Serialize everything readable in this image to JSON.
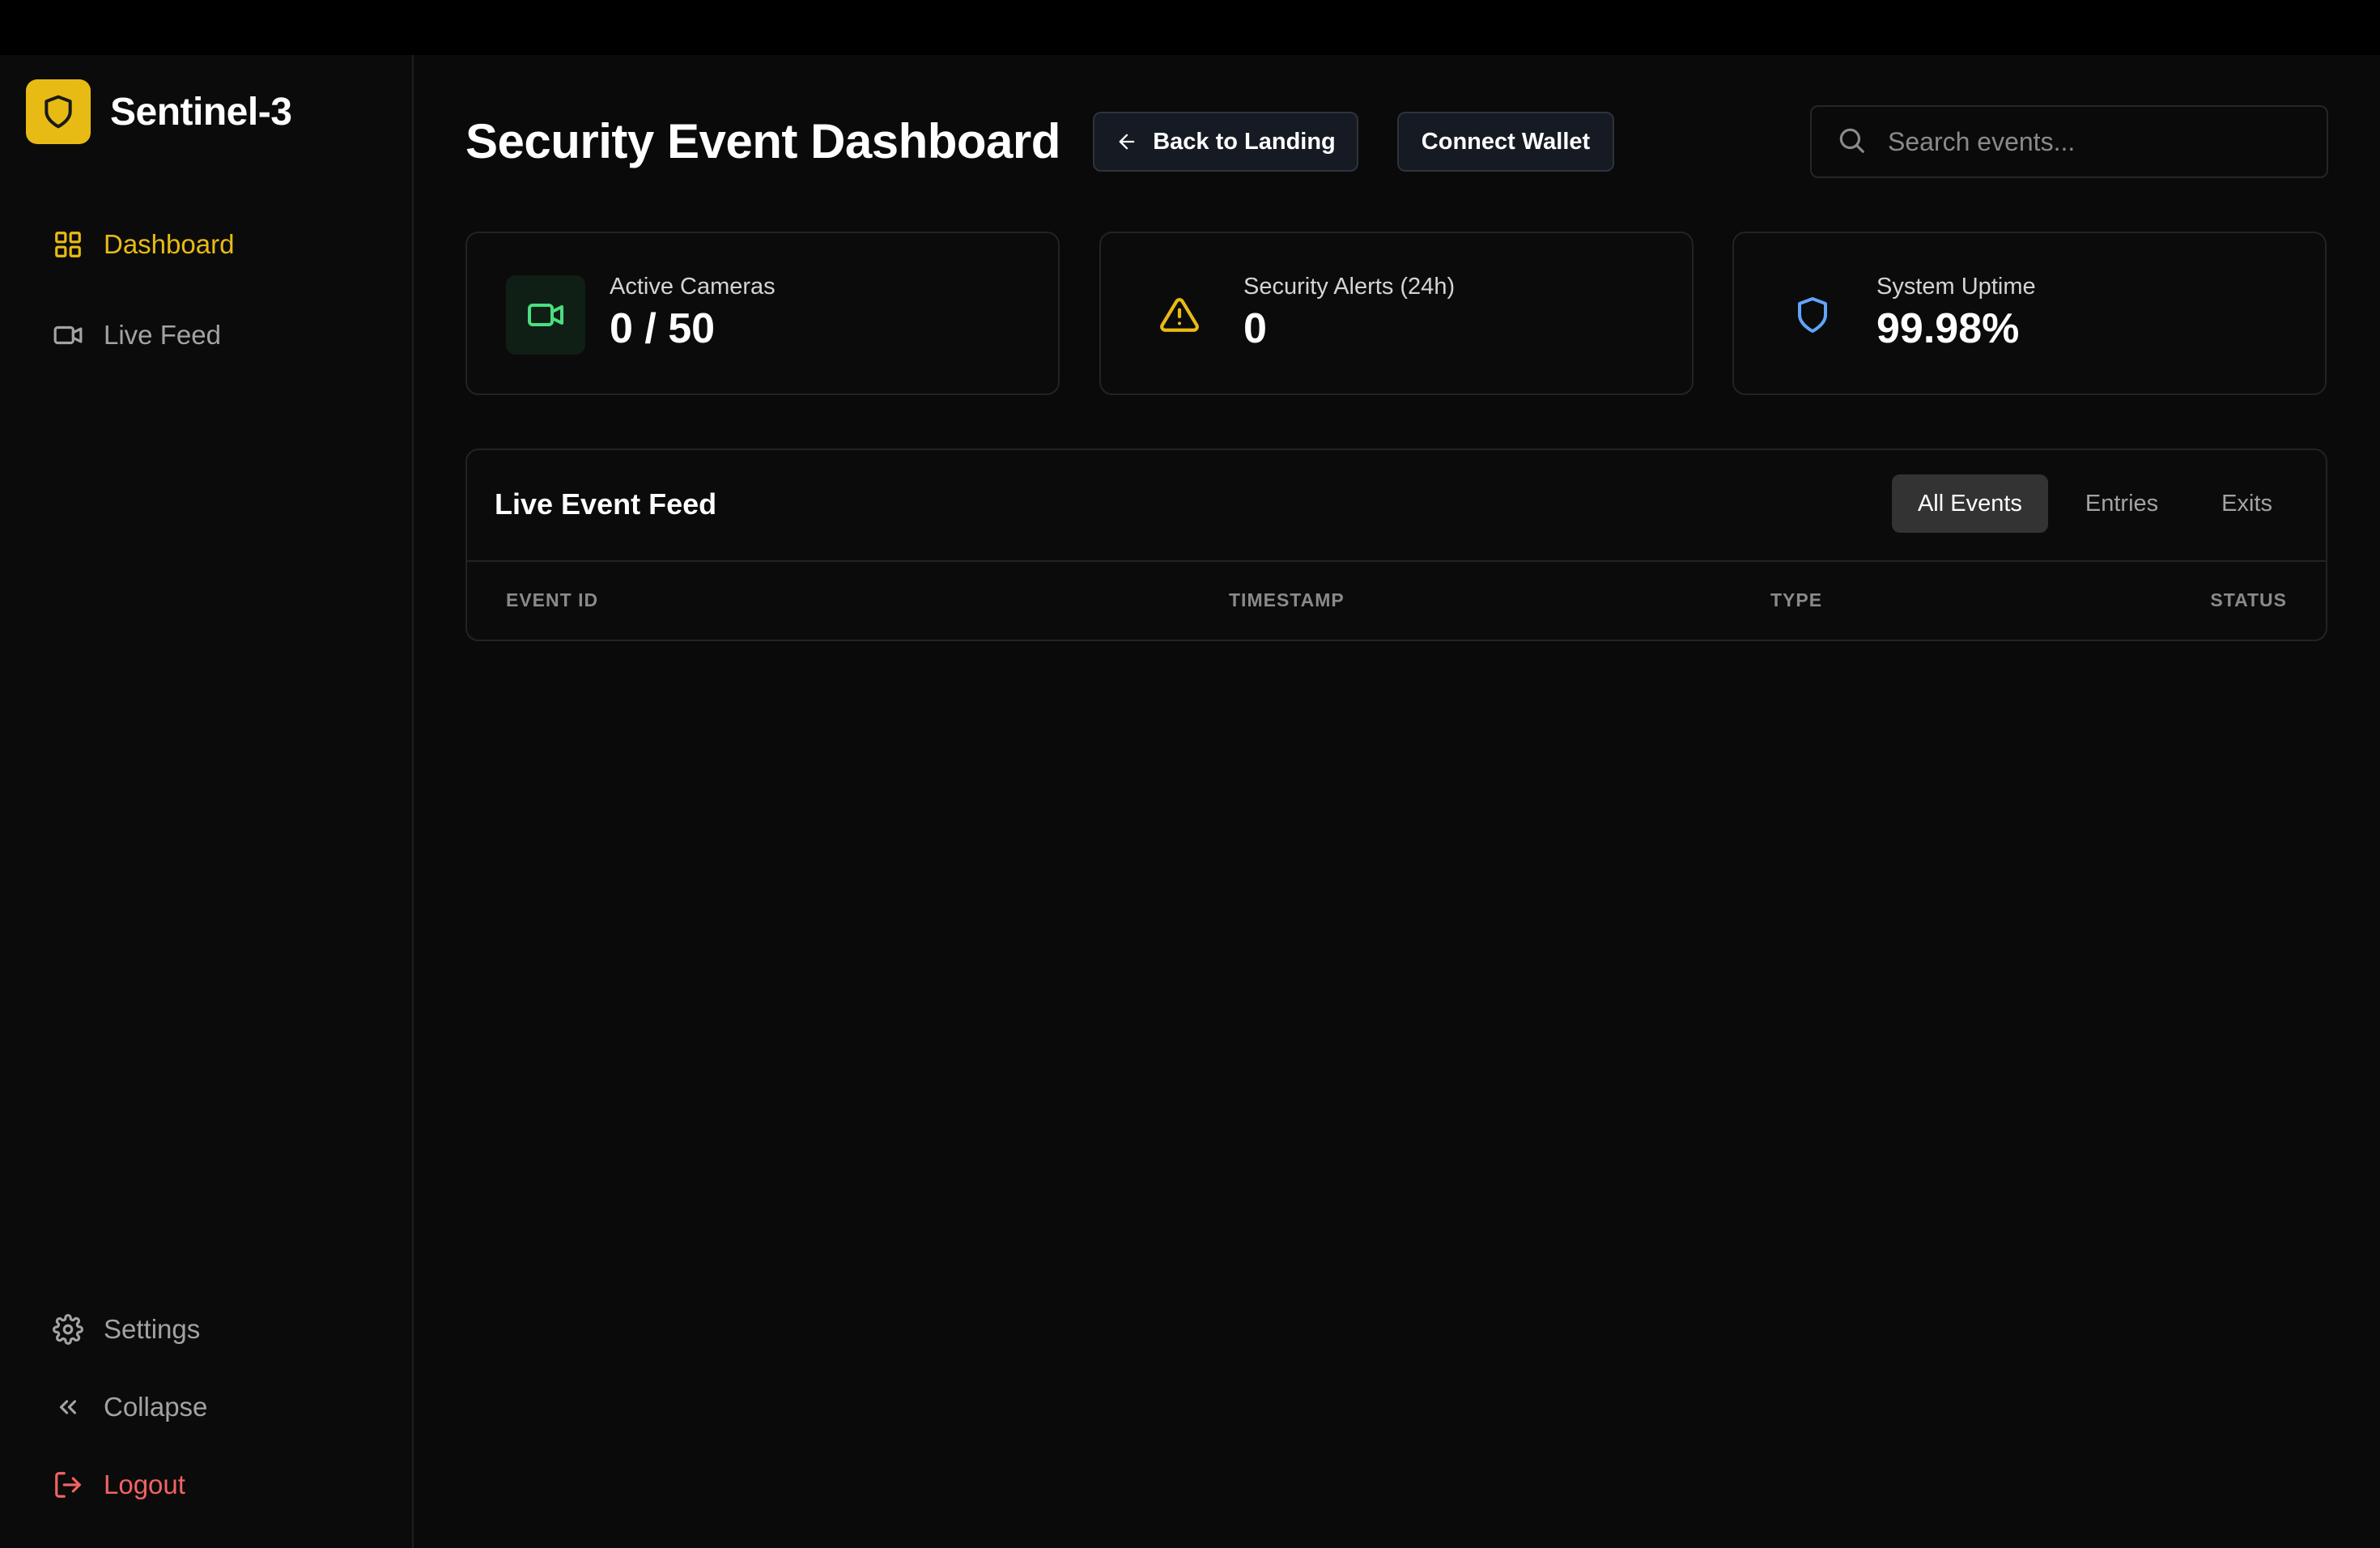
{
  "brand": {
    "name": "Sentinel-3"
  },
  "sidebar": {
    "items": [
      {
        "label": "Dashboard",
        "icon": "grid-icon",
        "active": true
      },
      {
        "label": "Live Feed",
        "icon": "video-icon",
        "active": false
      }
    ],
    "bottom": [
      {
        "label": "Settings",
        "icon": "gear-icon"
      },
      {
        "label": "Collapse",
        "icon": "chevrons-left-icon"
      },
      {
        "label": "Logout",
        "icon": "logout-icon"
      }
    ]
  },
  "header": {
    "title": "Security Event Dashboard",
    "back_label": "Back to Landing",
    "wallet_label": "Connect Wallet",
    "search_placeholder": "Search events...",
    "search_value": ""
  },
  "stats": [
    {
      "label": "Active Cameras",
      "value": "0 / 50",
      "icon": "video-icon",
      "color": "#4ade80"
    },
    {
      "label": "Security Alerts (24h)",
      "value": "0",
      "icon": "alert-triangle-icon",
      "color": "#e8bb14"
    },
    {
      "label": "System Uptime",
      "value": "99.98%",
      "icon": "shield-icon",
      "color": "#60a5fa"
    }
  ],
  "feed": {
    "title": "Live Event Feed",
    "tabs": [
      {
        "label": "All Events",
        "active": true
      },
      {
        "label": "Entries",
        "active": false
      },
      {
        "label": "Exits",
        "active": false
      }
    ],
    "columns": [
      "EVENT ID",
      "TIMESTAMP",
      "TYPE",
      "STATUS"
    ],
    "rows": []
  },
  "colors": {
    "accent": "#e8bb14",
    "danger": "#f26363",
    "background": "#0a0a0a"
  }
}
